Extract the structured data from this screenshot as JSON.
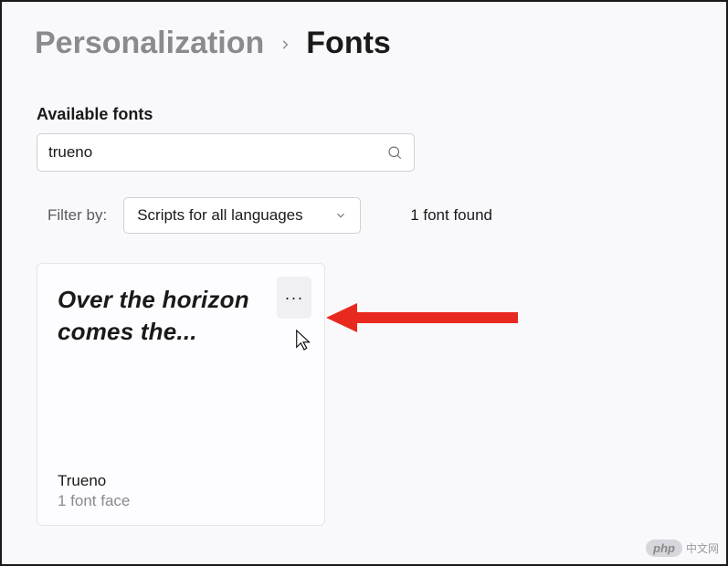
{
  "breadcrumb": {
    "parent": "Personalization",
    "current": "Fonts"
  },
  "section": {
    "available_label": "Available fonts"
  },
  "search": {
    "value": "trueno",
    "placeholder": ""
  },
  "filter": {
    "label": "Filter by:",
    "selected": "Scripts for all languages"
  },
  "results": {
    "count_text": "1 font found"
  },
  "font_card": {
    "preview_text": "Over the horizon comes the...",
    "name": "Trueno",
    "faces": "1 font face",
    "more_glyph": "···"
  },
  "watermark": {
    "badge": "php",
    "text": "中文网"
  }
}
